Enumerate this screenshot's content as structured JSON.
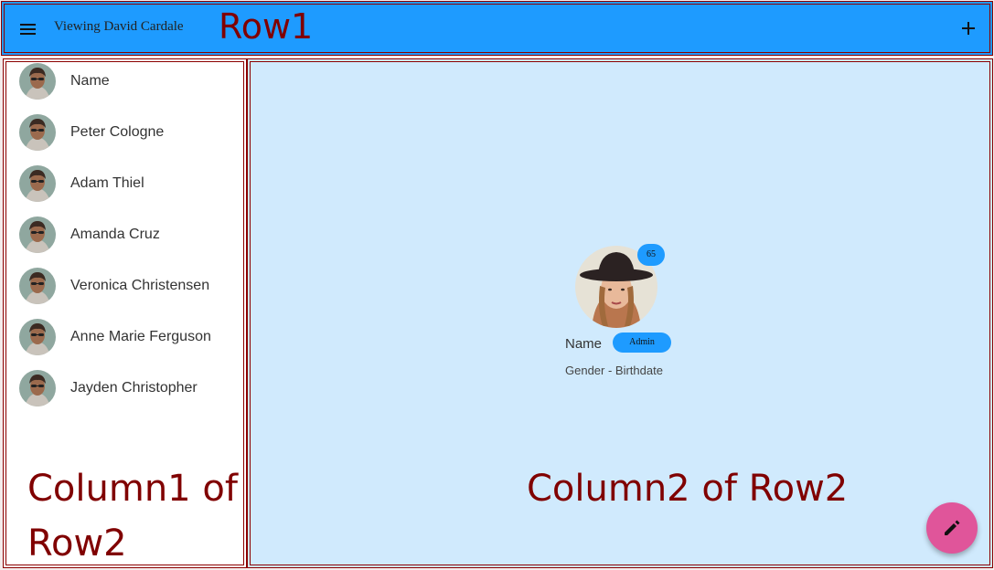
{
  "header": {
    "title": "Viewing David Cardale",
    "menu_icon": "hamburger-menu-icon",
    "add_icon": "plus-icon",
    "background": "#1e9bff"
  },
  "annotations": {
    "row1": "Row1",
    "column1_line1": "Column1 of",
    "column1_line2": "Row2",
    "column2": "Column2 of Row2",
    "color": "#800000"
  },
  "sidebar": {
    "items": [
      {
        "label": "Name"
      },
      {
        "label": "Peter Cologne"
      },
      {
        "label": "Adam Thiel"
      },
      {
        "label": "Amanda Cruz"
      },
      {
        "label": "Veronica Christensen"
      },
      {
        "label": "Anne Marie Ferguson"
      },
      {
        "label": "Jayden Christopher"
      }
    ]
  },
  "profile": {
    "count_badge": "65",
    "name": "Name",
    "role_badge": "Admin",
    "subtitle": "Gender - Birthdate",
    "background": "#d0eafd"
  },
  "fab": {
    "icon": "pencil-edit-icon",
    "color": "#e0559a"
  }
}
